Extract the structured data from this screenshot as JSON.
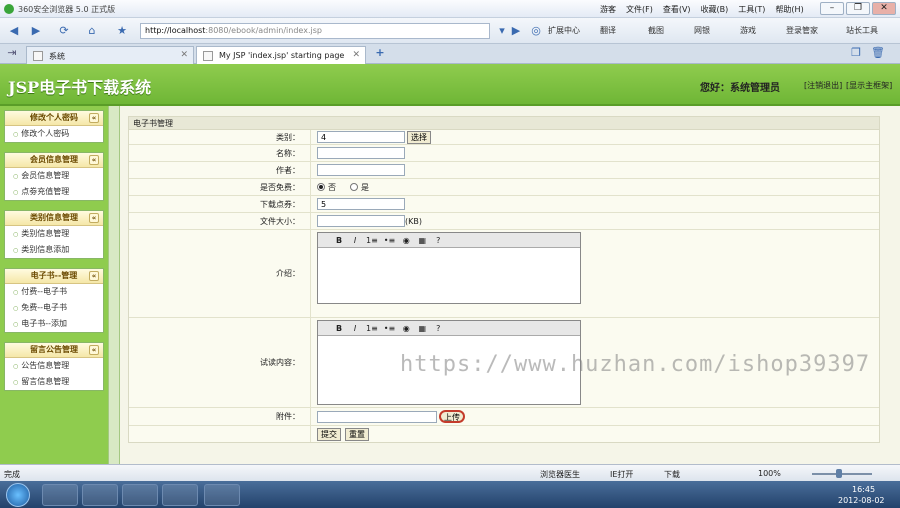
{
  "browser": {
    "title": "360安全浏览器 5.0 正式版",
    "menu": [
      "游客",
      "文件(F)",
      "查看(V)",
      "收藏(B)",
      "工具(T)",
      "帮助(H)"
    ],
    "address_host": "http://localhost",
    "address_rest": ":8080/ebook/admin/index.jsp",
    "toolbar": [
      "扩展中心",
      "翻译",
      "截图",
      "网银",
      "游戏",
      "登录管家",
      "站长工具"
    ],
    "tabs": [
      {
        "label": "系统"
      },
      {
        "label": "My JSP 'index.jsp' starting page"
      }
    ],
    "new_tab": "+"
  },
  "header": {
    "logo": "JSP电子书下载系统",
    "greeting": "您好：系统管理员",
    "logout": "[注销退出]",
    "home": "[显示主框架]"
  },
  "sidebar": {
    "groups": [
      {
        "title": "修改个人密码",
        "items": [
          "修改个人密码"
        ]
      },
      {
        "title": "会员信息管理",
        "items": [
          "会员信息管理",
          "点劵充值管理"
        ]
      },
      {
        "title": "类别信息管理",
        "items": [
          "类别信息管理",
          "类别信息添加"
        ]
      },
      {
        "title": "电子书--管理",
        "items": [
          "付费--电子书",
          "免费--电子书",
          "电子书--添加"
        ]
      },
      {
        "title": "留言公告管理",
        "items": [
          "公告信息管理",
          "留言信息管理"
        ]
      }
    ]
  },
  "form": {
    "title": "电子书管理",
    "category_label": "类别：",
    "category_value": "4",
    "category_button": "选择",
    "name_label": "名称：",
    "name_value": "",
    "author_label": "作者：",
    "author_value": "",
    "free_label": "是否免费：",
    "free_no": "否",
    "free_yes": "是",
    "points_label": "下载点券：",
    "points_value": "5",
    "size_label": "文件大小：",
    "size_value": "",
    "size_unit": "(KB)",
    "intro_label": "介绍：",
    "trial_label": "试读内容：",
    "attachment_label": "附件：",
    "upload_button": "上传",
    "submit_button": "提交",
    "reset_button": "重置",
    "editor_tools": [
      "B",
      "I",
      "1≡",
      "•≡",
      "◉",
      "▦",
      "?"
    ]
  },
  "status": {
    "left": "完成",
    "items": [
      "浏览器医生",
      "IE打开",
      "下载",
      "100%"
    ]
  },
  "taskbar": {
    "time": "16:45",
    "date": "2012-08-02"
  },
  "watermark": "https://www.huzhan.com/ishop39397"
}
